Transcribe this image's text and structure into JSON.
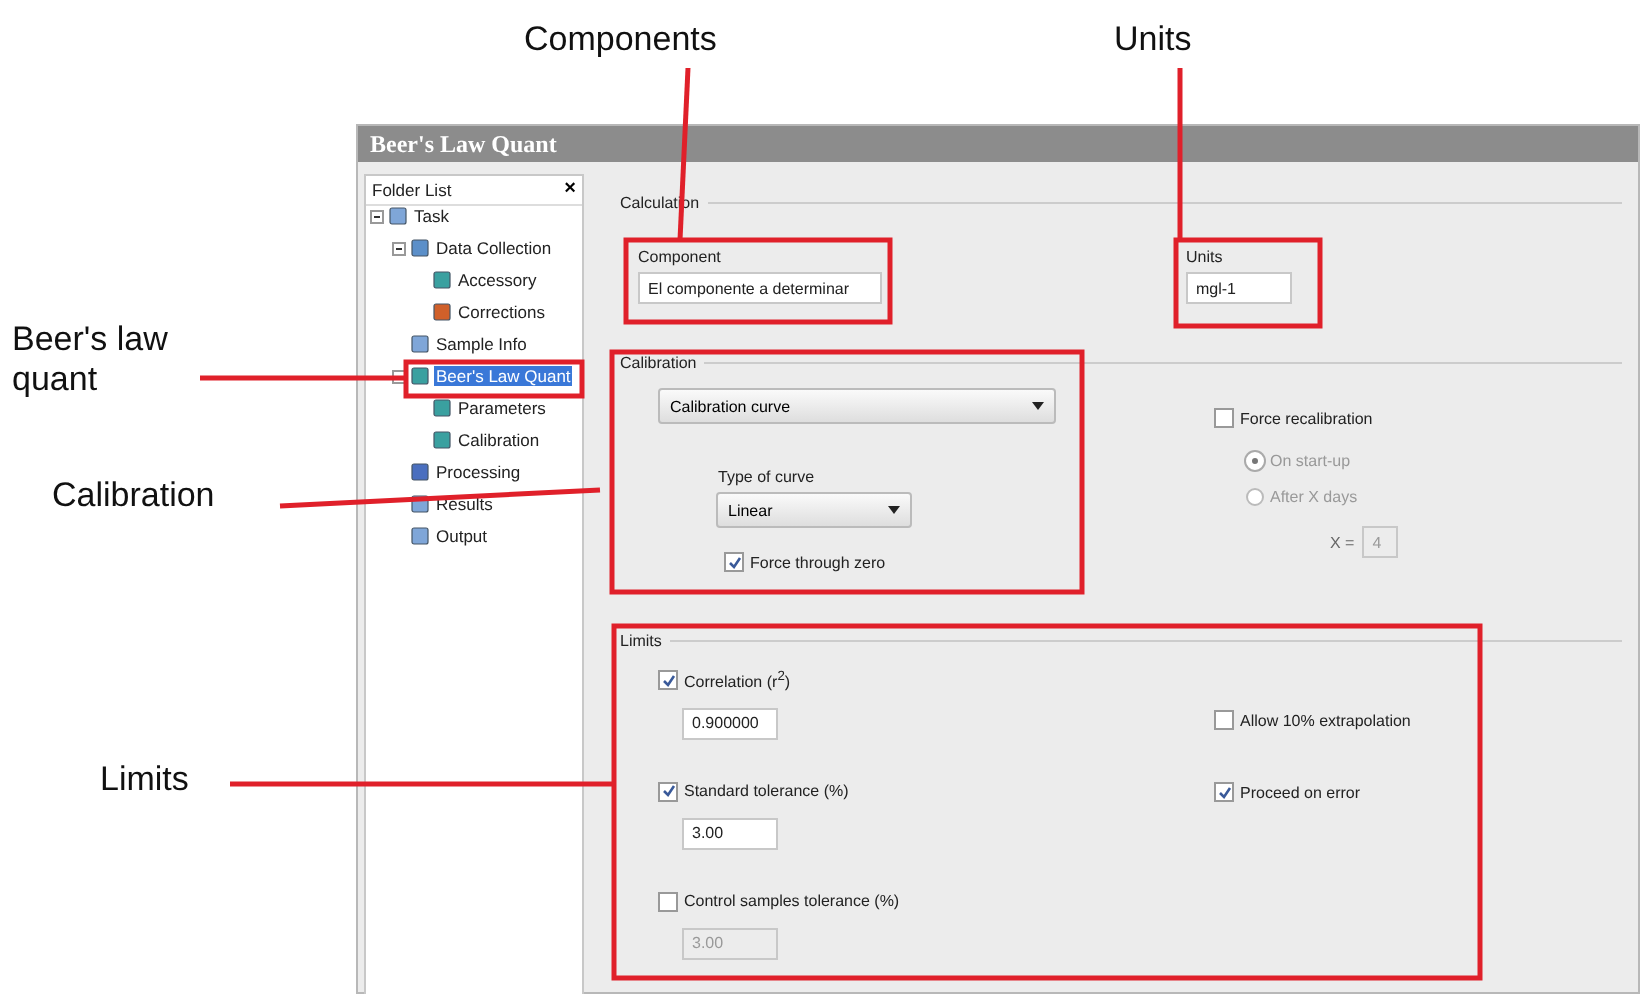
{
  "annotations": [
    {
      "text": "Components"
    },
    {
      "text": "Units"
    },
    {
      "text": "Beer's law quant"
    },
    {
      "text": "Calibration"
    },
    {
      "text": "Limits"
    }
  ],
  "window": {
    "title": "Beer's Law Quant"
  },
  "folder_list": {
    "title": "Folder List",
    "close": "×",
    "items": [
      {
        "label": "Task",
        "selected": false,
        "children": [
          {
            "label": "Data Collection",
            "selected": false,
            "children": [
              {
                "label": "Accessory",
                "selected": false
              },
              {
                "label": "Corrections",
                "selected": false
              }
            ]
          },
          {
            "label": "Sample Info",
            "selected": false
          },
          {
            "label": "Beer's Law Quant",
            "selected": true,
            "children": [
              {
                "label": "Parameters",
                "selected": false
              },
              {
                "label": "Calibration",
                "selected": false
              }
            ]
          },
          {
            "label": "Processing",
            "selected": false
          },
          {
            "label": "Results",
            "selected": false
          },
          {
            "label": "Output",
            "selected": false
          }
        ]
      }
    ]
  },
  "calculation": {
    "title": "Calculation",
    "component": {
      "label": "Component",
      "value": "El componente a determinar"
    },
    "units": {
      "label": "Units",
      "value": "mgl-1"
    }
  },
  "calibration": {
    "title": "Calibration",
    "method": "Calibration curve",
    "curve_type_label": "Type of curve",
    "curve_type": "Linear",
    "force_through_zero": {
      "label": "Force through zero",
      "checked": true
    },
    "force_recalibration": {
      "label": "Force recalibration",
      "checked": false
    },
    "options": [
      {
        "label": "On start-up",
        "selected": true
      },
      {
        "label": "After X days",
        "selected": false
      }
    ],
    "options_disabled": true,
    "x_label": "X =",
    "x_value": "4"
  },
  "limits": {
    "title": "Limits",
    "left": [
      {
        "label": "Correlation (r$^{2}$)",
        "checked": true,
        "value": "0.900000"
      },
      {
        "label": "Standard tolerance (%)",
        "checked": true,
        "value": "3.00"
      },
      {
        "label": "Control samples tolerance (%)",
        "checked": false,
        "value": "3.00"
      }
    ],
    "right": [
      {
        "label": "Allow 10% extrapolation",
        "checked": false
      },
      {
        "label": "Proceed on error",
        "checked": true
      }
    ]
  }
}
